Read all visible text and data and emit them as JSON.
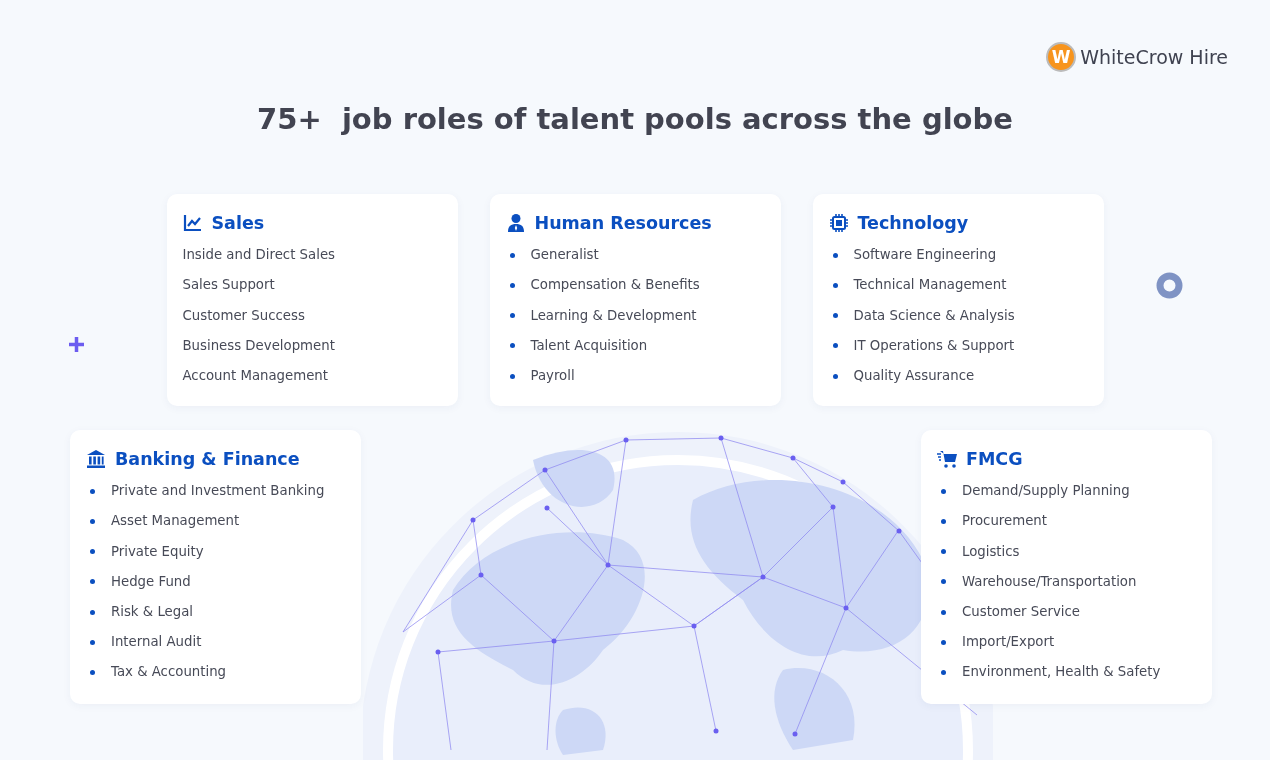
{
  "logo": {
    "mark": "W",
    "name": "WhiteCrow Hire"
  },
  "headline": "75+  job roles of talent pools across the globe",
  "categories": [
    {
      "title": "Sales",
      "bulleted": false,
      "roles": [
        "Inside and Direct Sales",
        "Sales Support",
        "Customer Success",
        "Business Development",
        "Account Management"
      ]
    },
    {
      "title": "Human Resources",
      "bulleted": true,
      "roles": [
        "Generalist",
        "Compensation & Benefits",
        "Learning & Development",
        "Talent Acquisition",
        "Payroll"
      ]
    },
    {
      "title": "Technology",
      "bulleted": true,
      "roles": [
        "Software Engineering",
        "Technical Management",
        "Data Science & Analysis",
        "IT Operations & Support",
        "Quality Assurance"
      ]
    },
    {
      "title": "Banking & Finance",
      "bulleted": true,
      "roles": [
        "Private and Investment Banking",
        "Asset Management",
        "Private Equity",
        "Hedge Fund",
        "Risk & Legal",
        "Internal Audit",
        "Tax & Accounting"
      ]
    },
    {
      "title": "FMCG",
      "bulleted": true,
      "roles": [
        "Demand/Supply Planning",
        "Procurement",
        "Logistics",
        "Warehouse/Transportation",
        "Customer Service",
        "Import/Export",
        "Environment, Health & Safety"
      ]
    }
  ]
}
